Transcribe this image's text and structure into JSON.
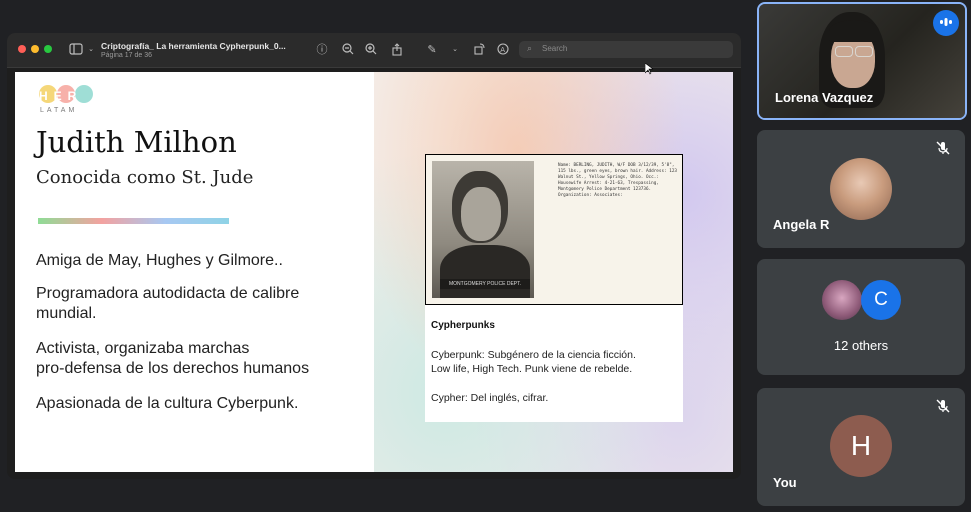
{
  "window": {
    "title": "Criptografía_ La herramienta Cypherpunk_0...",
    "subtitle": "Página 17 de 36",
    "search_placeholder": "Search",
    "toolbar_icons": [
      "sidebar-icon",
      "info-icon",
      "zoom-out-icon",
      "zoom-in-icon",
      "share-icon",
      "markup-icon",
      "rotate-icon",
      "annotate-icon"
    ]
  },
  "slide": {
    "logo_letters": "HER",
    "logo_sub": "LATAM",
    "name": "Judith Milhon",
    "alias": "Conocida como St. Jude",
    "bullets": [
      {
        "line1": "Amiga de May, Hughes y Gilmore..",
        "line2": ""
      },
      {
        "line1": "Programadora autodidacta de calibre",
        "line2": "mundial."
      },
      {
        "line1": "Activista, organizaba marchas",
        "line2": "pro-defensa de los derechos humanos"
      },
      {
        "line1": "Apasionada de la cultura Cyberpunk.",
        "line2": ""
      }
    ],
    "card": {
      "mugshot_plate": "MONTGOMERY POLICE DEPT.",
      "mugshot_text": "Name: BERLING, JUDITH, W/F DOB 3/12/39, 5'8\", 115 lbs., green eyes, brown hair. Address: 123 Walnut St., Yellow Springs, Ohio. Occ.: Housewife Arrest: 4-21-63, Trespassing, Montgomery Police Department 123736. Organization: Associates:",
      "title": "Cypherpunks",
      "line1": "Cyberpunk: Subgénero de la ciencia ficción.",
      "line2": "Low life, High Tech. Punk viene de rebelde.",
      "line3": "Cypher: Del inglés, cifrar."
    }
  },
  "participants": {
    "presenter": {
      "name": "Lorena Vazquez"
    },
    "p2": {
      "name": "Angela R"
    },
    "others": {
      "label": "12 others",
      "avatar_letter": "C",
      "avatar_color": "#1a73e8"
    },
    "you": {
      "name": "You",
      "avatar_letter": "H",
      "avatar_color": "#8d5c4f"
    }
  },
  "colors": {
    "accent": "#8ab4f8",
    "tile_bg": "#3c4043",
    "speaking": "#1a73e8"
  }
}
